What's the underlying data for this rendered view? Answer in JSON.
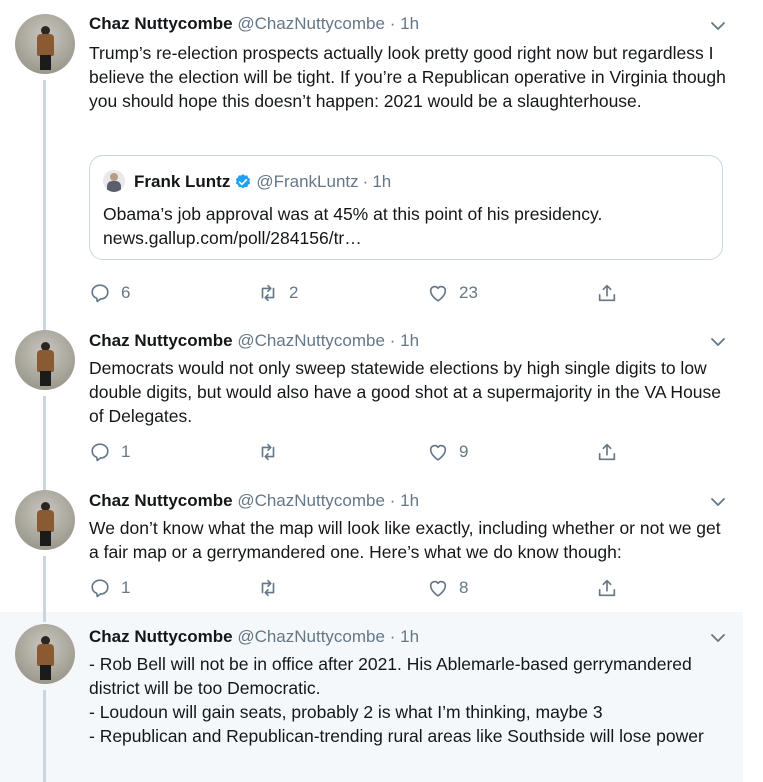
{
  "colors": {
    "accent": "#1da1f2",
    "muted": "#657786",
    "border": "#ccd6dd",
    "highlight_bg": "#f5f8fa"
  },
  "tweets": [
    {
      "name": "Chaz Nuttycombe",
      "handle": "@ChazNuttycombe",
      "dot": "·",
      "time": "1h",
      "text": "Trump’s re-election prospects actually look pretty good right now but regardless I believe the election will be tight. If you’re a Republican operative in Virginia though you should hope this doesn’t happen: 2021 would be a slaughterhouse.",
      "quote": {
        "name": "Frank Luntz",
        "handle": "@FrankLuntz",
        "dot": "·",
        "time": "1h",
        "text": "Obama’s job approval was at 45% at this point of his presidency.",
        "link": "news.gallup.com/poll/284156/tr…"
      },
      "replies": "6",
      "retweets": "2",
      "likes": "23"
    },
    {
      "name": "Chaz Nuttycombe",
      "handle": "@ChazNuttycombe",
      "dot": "·",
      "time": "1h",
      "text": "Democrats would not only sweep statewide elections by high single digits to low double digits, but would also have a good shot at a supermajority in the VA House of Delegates.",
      "replies": "1",
      "retweets": "",
      "likes": "9"
    },
    {
      "name": "Chaz Nuttycombe",
      "handle": "@ChazNuttycombe",
      "dot": "·",
      "time": "1h",
      "text": "We don’t know what the map will look like exactly, including whether or not we get a fair map or a gerrymandered one. Here’s what we do know though:",
      "replies": "1",
      "retweets": "",
      "likes": "8"
    },
    {
      "name": "Chaz Nuttycombe",
      "handle": "@ChazNuttycombe",
      "dot": "·",
      "time": "1h",
      "text_lines": [
        "- Rob Bell will not be in office after 2021. His Ablemarle-based gerrymandered district will be too Democratic.",
        "- Loudoun will gain seats, probably 2 is what I’m thinking, maybe 3",
        "- Republican and Republican-trending rural areas like Southside will lose power"
      ]
    }
  ]
}
